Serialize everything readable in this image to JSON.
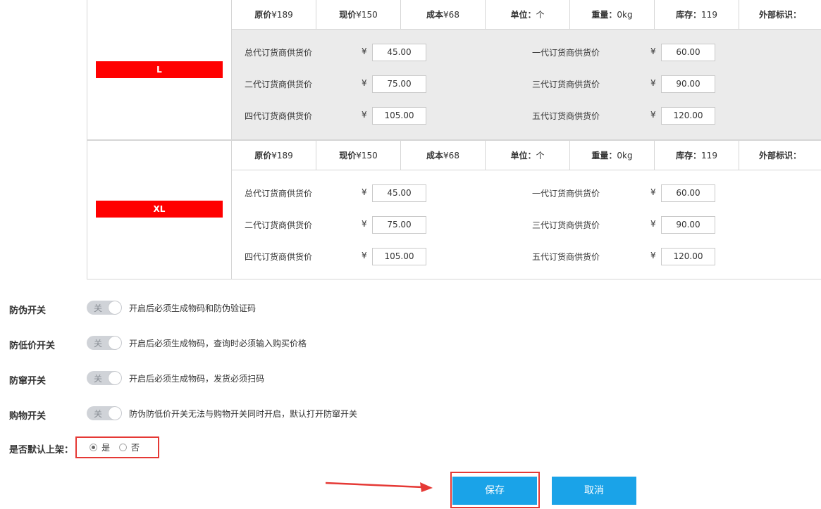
{
  "skus": [
    {
      "size": "L",
      "info": {
        "original_label": "原价",
        "original_value": "¥189",
        "current_label": "现价",
        "current_value": "¥150",
        "cost_label": "成本",
        "cost_value": "¥68",
        "unit_label": "单位：",
        "unit_value": "个",
        "weight_label": "重量：",
        "weight_value": "0kg",
        "stock_label": "库存：",
        "stock_value": "119",
        "external_label": "外部标识："
      },
      "prices": [
        {
          "label": "总代订货商供货价",
          "currency": "¥",
          "value": "45.00"
        },
        {
          "label": "一代订货商供货价",
          "currency": "¥",
          "value": "60.00"
        },
        {
          "label": "二代订货商供货价",
          "currency": "¥",
          "value": "75.00"
        },
        {
          "label": "三代订货商供货价",
          "currency": "¥",
          "value": "90.00"
        },
        {
          "label": "四代订货商供货价",
          "currency": "¥",
          "value": "105.00"
        },
        {
          "label": "五代订货商供货价",
          "currency": "¥",
          "value": "120.00"
        }
      ]
    },
    {
      "size": "XL",
      "info": {
        "original_label": "原价",
        "original_value": "¥189",
        "current_label": "现价",
        "current_value": "¥150",
        "cost_label": "成本",
        "cost_value": "¥68",
        "unit_label": "单位：",
        "unit_value": "个",
        "weight_label": "重量：",
        "weight_value": "0kg",
        "stock_label": "库存：",
        "stock_value": "119",
        "external_label": "外部标识："
      },
      "prices": [
        {
          "label": "总代订货商供货价",
          "currency": "¥",
          "value": "45.00"
        },
        {
          "label": "一代订货商供货价",
          "currency": "¥",
          "value": "60.00"
        },
        {
          "label": "二代订货商供货价",
          "currency": "¥",
          "value": "75.00"
        },
        {
          "label": "三代订货商供货价",
          "currency": "¥",
          "value": "90.00"
        },
        {
          "label": "四代订货商供货价",
          "currency": "¥",
          "value": "105.00"
        },
        {
          "label": "五代订货商供货价",
          "currency": "¥",
          "value": "120.00"
        }
      ]
    }
  ],
  "switches": [
    {
      "label": "防伪开关",
      "state": "关",
      "desc": "开启后必须生成物码和防伪验证码"
    },
    {
      "label": "防低价开关",
      "state": "关",
      "desc": "开启后必须生成物码，查询时必须输入购买价格"
    },
    {
      "label": "防窜开关",
      "state": "关",
      "desc": "开启后必须生成物码，发货必须扫码"
    },
    {
      "label": "购物开关",
      "state": "关",
      "desc": "防伪防低价开关无法与购物开关同时开启，默认打开防窜开关"
    }
  ],
  "default_shelf": {
    "label": "是否默认上架：",
    "options": [
      "是",
      "否"
    ],
    "selected": "是"
  },
  "actions": {
    "save_label": "保存",
    "cancel_label": "取消"
  },
  "colors": {
    "size_tag": "#ff0000",
    "button": "#1aa3e8",
    "highlight": "#e53935"
  }
}
